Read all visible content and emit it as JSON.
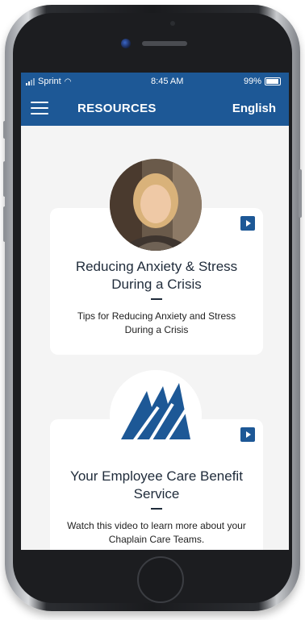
{
  "status_bar": {
    "carrier": "Sprint",
    "time": "8:45 AM",
    "battery": "99%"
  },
  "nav": {
    "title": "RESOURCES",
    "language": "English"
  },
  "cards": [
    {
      "title": "Reducing Anxiety & Stress During a Crisis",
      "description": "Tips for Reducing Anxiety and Stress During a Crisis",
      "icon": "video-icon"
    },
    {
      "title": "Your Employee Care Benefit Service",
      "description": "Watch this video to learn more about your Chaplain Care Teams.",
      "icon": "video-icon"
    }
  ],
  "colors": {
    "brand": "#1d5896",
    "background": "#f4f4f4"
  }
}
